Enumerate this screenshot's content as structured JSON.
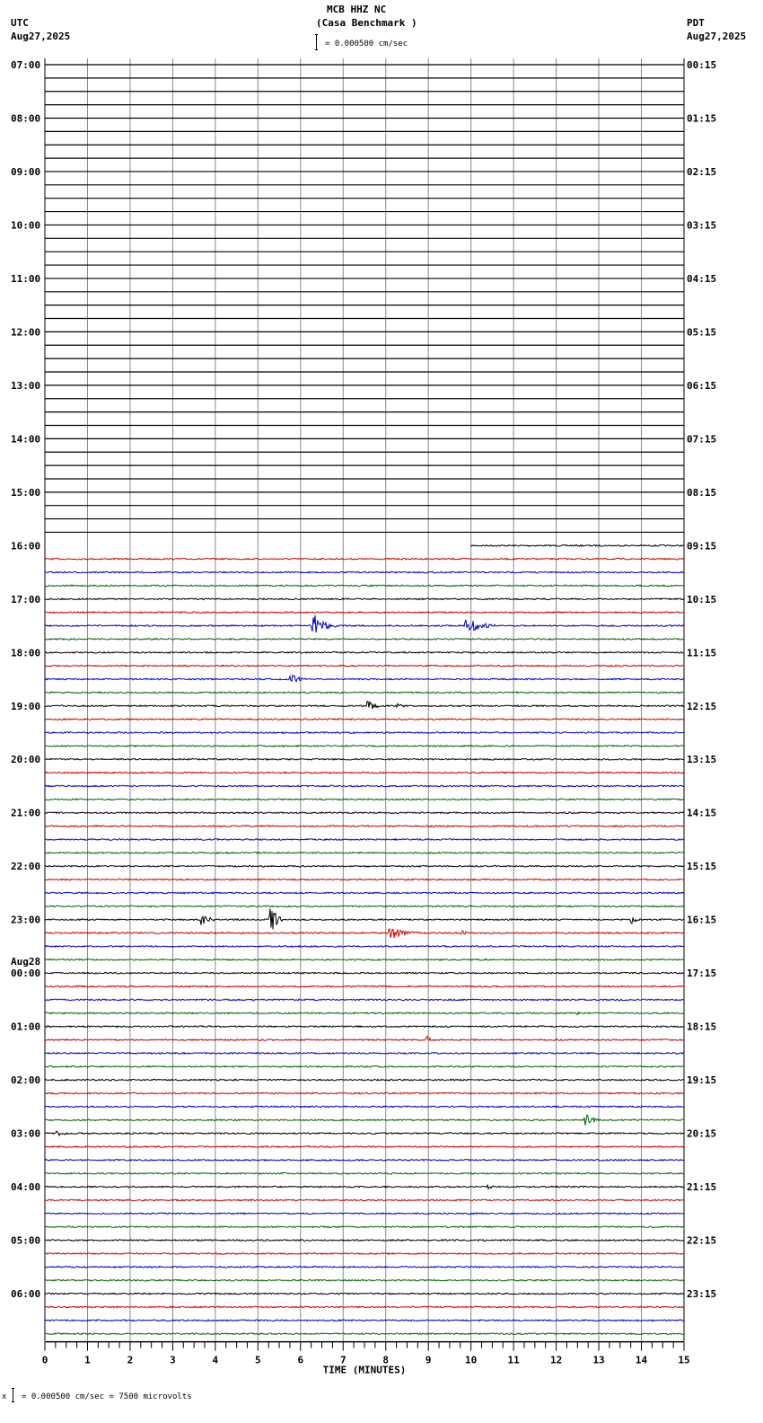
{
  "header": {
    "station": "MCB HHZ NC",
    "site": "(Casa Benchmark )",
    "left_tz": "UTC",
    "left_date": "Aug27,2025",
    "right_tz": "PDT",
    "right_date": "Aug27,2025",
    "scale_label": "= 0.000500 cm/sec"
  },
  "footer": {
    "scale_prefix": "х",
    "scale_label": "= 0.000500 cm/sec =    7500 microvolts"
  },
  "chart_data": {
    "type": "line",
    "title": "MCB HHZ NC (Casa Benchmark )",
    "xlabel": "TIME (MINUTES)",
    "xlim": [
      0,
      15
    ],
    "x_ticks": [
      "0",
      "1",
      "2",
      "3",
      "4",
      "5",
      "6",
      "7",
      "8",
      "9",
      "10",
      "11",
      "12",
      "13",
      "14",
      "15"
    ],
    "lines_total": 96,
    "minutes_per_line": 15,
    "trace_colors": [
      "#000000",
      "#cc0000",
      "#0000cc",
      "#006600"
    ],
    "data_start_line": 36,
    "data_start_minute": 10,
    "left_labels": [
      "07:00",
      "08:00",
      "09:00",
      "10:00",
      "11:00",
      "12:00",
      "13:00",
      "14:00",
      "15:00",
      "16:00",
      "17:00",
      "18:00",
      "19:00",
      "20:00",
      "21:00",
      "22:00",
      "23:00",
      "00:00",
      "01:00",
      "02:00",
      "03:00",
      "04:00",
      "05:00",
      "06:00"
    ],
    "date_change_label": "Aug28",
    "right_labels": [
      "00:15",
      "01:15",
      "02:15",
      "03:15",
      "04:15",
      "05:15",
      "06:15",
      "07:15",
      "08:15",
      "09:15",
      "10:15",
      "11:15",
      "12:15",
      "13:15",
      "14:15",
      "15:15",
      "16:15",
      "17:15",
      "18:15",
      "19:15",
      "20:15",
      "21:15",
      "22:15",
      "23:15"
    ],
    "events": [
      {
        "line": 42,
        "minute": 6.3,
        "amplitude": 14,
        "duration": 0.6
      },
      {
        "line": 42,
        "minute": 9.9,
        "amplitude": 8,
        "duration": 1.0
      },
      {
        "line": 46,
        "minute": 5.8,
        "amplitude": 5,
        "duration": 0.5
      },
      {
        "line": 48,
        "minute": 7.6,
        "amplitude": 6,
        "duration": 0.5
      },
      {
        "line": 48,
        "minute": 8.3,
        "amplitude": 3,
        "duration": 0.5
      },
      {
        "line": 64,
        "minute": 3.7,
        "amplitude": 7,
        "duration": 0.4
      },
      {
        "line": 64,
        "minute": 5.3,
        "amplitude": 20,
        "duration": 0.3
      },
      {
        "line": 64,
        "minute": 13.8,
        "amplitude": 5,
        "duration": 0.3
      },
      {
        "line": 65,
        "minute": 8.1,
        "amplitude": 8,
        "duration": 0.8
      },
      {
        "line": 65,
        "minute": 9.8,
        "amplitude": 3,
        "duration": 0.3
      },
      {
        "line": 71,
        "minute": 12.5,
        "amplitude": 2,
        "duration": 0.4
      },
      {
        "line": 73,
        "minute": 9.0,
        "amplitude": 4,
        "duration": 0.2
      },
      {
        "line": 79,
        "minute": 12.7,
        "amplitude": 9,
        "duration": 0.4
      },
      {
        "line": 80,
        "minute": 0.3,
        "amplitude": 3,
        "duration": 0.5
      },
      {
        "line": 84,
        "minute": 10.4,
        "amplitude": 3,
        "duration": 0.3
      },
      {
        "line": 85,
        "minute": 4.8,
        "amplitude": 3,
        "duration": 0.3
      }
    ]
  }
}
